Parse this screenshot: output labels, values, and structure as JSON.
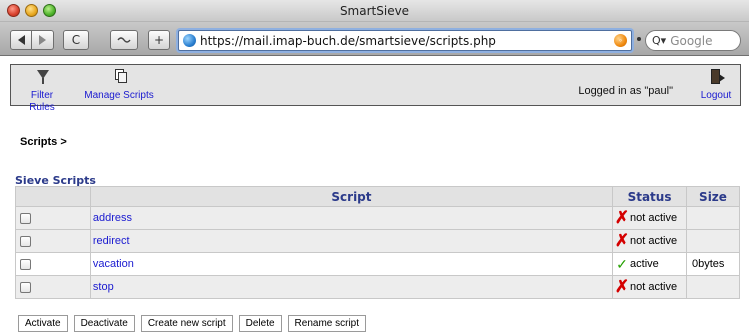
{
  "browser": {
    "window_title": "SmartSieve",
    "url": "https://mail.imap-buch.de/smartsieve/scripts.php",
    "search_placeholder": "Google",
    "reload_glyph": "C",
    "add_glyph": "+"
  },
  "header": {
    "nav": [
      {
        "label": "Filter Rules",
        "icon": "filter-icon"
      },
      {
        "label": "Manage Scripts",
        "icon": "documents-icon"
      }
    ],
    "logged_in_text": "Logged in as \"paul\"",
    "logout_label": "Logout",
    "logout_icon": "exit-door-icon"
  },
  "breadcrumb": "Scripts >",
  "section_title": "Sieve Scripts",
  "table": {
    "columns": [
      "",
      "Script",
      "Status",
      "Size"
    ],
    "rows": [
      {
        "name": "address",
        "status": "not active",
        "active": false,
        "size": ""
      },
      {
        "name": "redirect",
        "status": "not active",
        "active": false,
        "size": ""
      },
      {
        "name": "vacation",
        "status": "active",
        "active": true,
        "size": "0bytes"
      },
      {
        "name": "stop",
        "status": "not active",
        "active": false,
        "size": ""
      }
    ]
  },
  "actions": [
    "Activate",
    "Deactivate",
    "Create new script",
    "Delete",
    "Rename script"
  ],
  "colors": {
    "link": "#1a1ad0",
    "heading": "#2b3a8a",
    "inactive": "#d40000",
    "active": "#24a000"
  }
}
